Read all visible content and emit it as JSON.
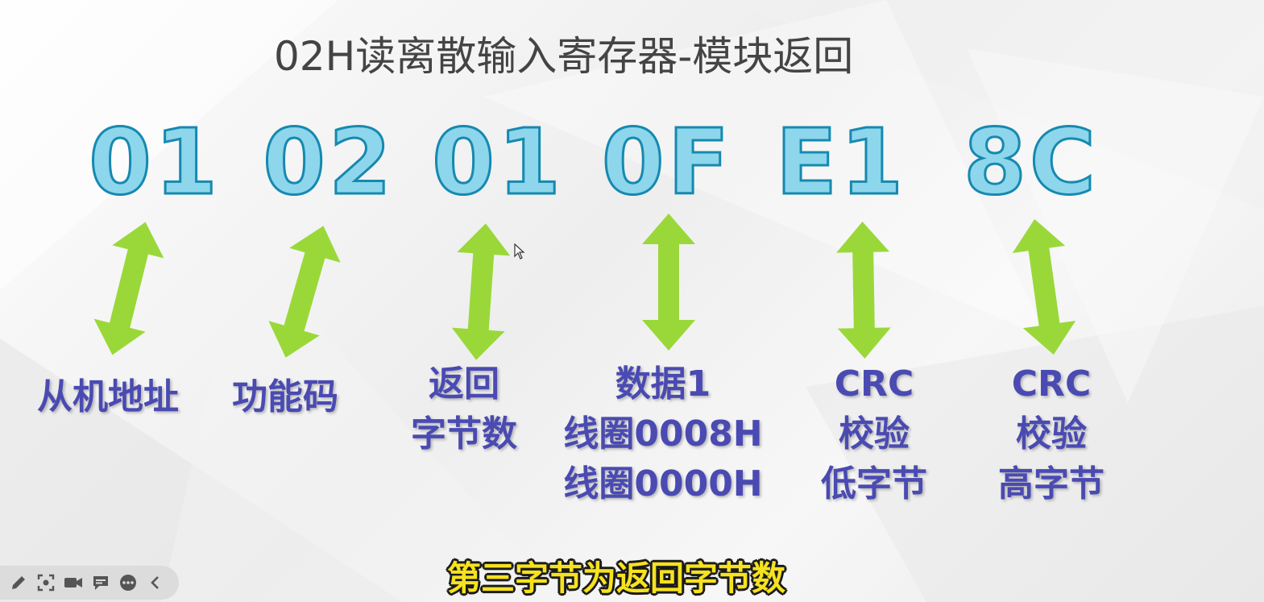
{
  "slide": {
    "title": "02H读离散输入寄存器-模块返回",
    "bytes": [
      {
        "hex": "01",
        "lines": [
          "从机地址"
        ]
      },
      {
        "hex": "02",
        "lines": [
          "功能码"
        ]
      },
      {
        "hex": "01",
        "lines": [
          "返回",
          "字节数"
        ]
      },
      {
        "hex": "0F",
        "lines": [
          "数据1",
          "线圈0008H",
          "线圈0000H"
        ]
      },
      {
        "hex": "E1",
        "lines": [
          "CRC",
          "校验",
          "低字节"
        ]
      },
      {
        "hex": "8C",
        "lines": [
          "CRC",
          "校验",
          "高字节"
        ]
      }
    ],
    "subtitle": "第三字节为返回字节数"
  },
  "colors": {
    "hex_fill": "#8dd6ec",
    "hex_stroke": "#1689b0",
    "arrow": "#9ad83a",
    "label": "#4a4ab2",
    "subtitle": "#f6e21f"
  },
  "toolbar": {
    "icons": [
      "pen-icon",
      "screenshot-icon",
      "camera-icon",
      "comment-icon",
      "more-icon",
      "collapse-chevron-icon"
    ]
  }
}
